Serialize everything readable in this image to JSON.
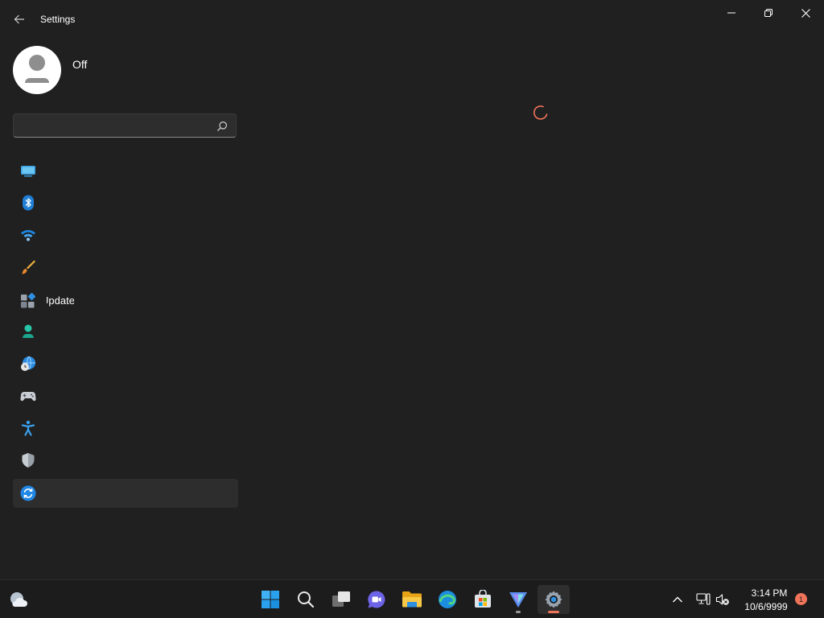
{
  "window": {
    "title": "Settings",
    "back_icon": "back-arrow-icon",
    "controls": [
      "minimize-icon",
      "restore-icon",
      "close-icon"
    ]
  },
  "profile": {
    "name": "Off",
    "avatar_icon": "user-avatar-icon"
  },
  "search": {
    "value": "",
    "placeholder": "",
    "icon": "search-icon"
  },
  "nav": {
    "items": [
      {
        "icon": "display-icon",
        "label": ""
      },
      {
        "icon": "bluetooth-icon",
        "label": ""
      },
      {
        "icon": "wifi-icon",
        "label": ""
      },
      {
        "icon": "paintbrush-icon",
        "label": ""
      },
      {
        "icon": "apps-icon",
        "label": "Update"
      },
      {
        "icon": "person-icon",
        "label": ""
      },
      {
        "icon": "globe-clock-icon",
        "label": ""
      },
      {
        "icon": "gamepad-icon",
        "label": ""
      },
      {
        "icon": "accessibility-icon",
        "label": ""
      },
      {
        "icon": "shield-icon",
        "label": ""
      },
      {
        "icon": "windows-update-icon",
        "label": "",
        "selected": true
      }
    ]
  },
  "content": {
    "loading_icon": "loading-spinner-icon",
    "accent_color": "#f0745a"
  },
  "taskbar": {
    "weather_icon": "weather-icon",
    "apps": [
      "start-icon",
      "search-icon",
      "task-view-icon",
      "chat-icon",
      "file-explorer-icon",
      "edge-icon",
      "store-icon",
      "app-icon",
      "settings-icon"
    ],
    "tray": [
      "chevron-up-icon",
      "network-icon",
      "volume-muted-icon"
    ],
    "time": "3:14 PM",
    "date": "10/6/9999",
    "notification_count": "1"
  }
}
